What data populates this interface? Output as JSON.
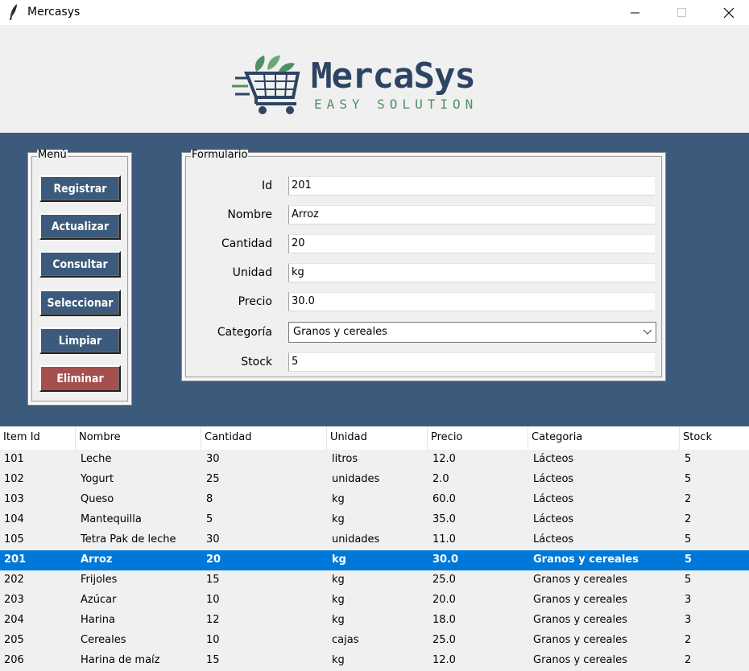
{
  "window": {
    "title": "Mercasys"
  },
  "logo": {
    "brand": "MercaSys",
    "tagline": "EASY SOLUTION"
  },
  "menu": {
    "legend": "Menú",
    "buttons": [
      "Registrar",
      "Actualizar",
      "Consultar",
      "Seleccionar",
      "Limpiar",
      "Eliminar"
    ]
  },
  "form": {
    "legend": "Formulario",
    "fields": [
      {
        "label": "Id",
        "value": "201"
      },
      {
        "label": "Nombre",
        "value": "Arroz"
      },
      {
        "label": "Cantidad",
        "value": "20"
      },
      {
        "label": "Unidad",
        "value": "kg"
      },
      {
        "label": "Precio",
        "value": "30.0"
      },
      {
        "label": "Categoría",
        "value": "Granos y cereales"
      },
      {
        "label": "Stock",
        "value": "5"
      }
    ]
  },
  "table": {
    "columns": [
      "Item Id",
      "Nombre",
      "Cantidad",
      "Unidad",
      "Precio",
      "Categoria",
      "Stock"
    ],
    "selected_row": 5,
    "rows": [
      [
        "101",
        "Leche",
        "30",
        "litros",
        "12.0",
        "Lácteos",
        "5"
      ],
      [
        "102",
        "Yogurt",
        "25",
        "unidades",
        "2.0",
        "Lácteos",
        "5"
      ],
      [
        "103",
        "Queso",
        "8",
        "kg",
        "60.0",
        "Lácteos",
        "2"
      ],
      [
        "104",
        "Mantequilla",
        "5",
        "kg",
        "35.0",
        "Lácteos",
        "2"
      ],
      [
        "105",
        "Tetra Pak de leche",
        "30",
        "unidades",
        "11.0",
        "Lácteos",
        "5"
      ],
      [
        "201",
        "Arroz",
        "20",
        "kg",
        "30.0",
        "Granos y cereales",
        "5"
      ],
      [
        "202",
        "Frijoles",
        "15",
        "kg",
        "25.0",
        "Granos y cereales",
        "5"
      ],
      [
        "203",
        "Azúcar",
        "10",
        "kg",
        "20.0",
        "Granos y cereales",
        "3"
      ],
      [
        "204",
        "Harina",
        "12",
        "kg",
        "18.0",
        "Granos y cereales",
        "3"
      ],
      [
        "205",
        "Cereales",
        "10",
        "cajas",
        "25.0",
        "Granos y cereales",
        "2"
      ],
      [
        "206",
        "Harina de maíz",
        "15",
        "kg",
        "12.0",
        "Granos y cereales",
        "2"
      ]
    ]
  },
  "colors": {
    "header_blue": "#3c5a7c",
    "brand": "#2d4462",
    "accent_green": "#4f8f63",
    "danger": "#a5504f",
    "selection": "#0078d7"
  }
}
